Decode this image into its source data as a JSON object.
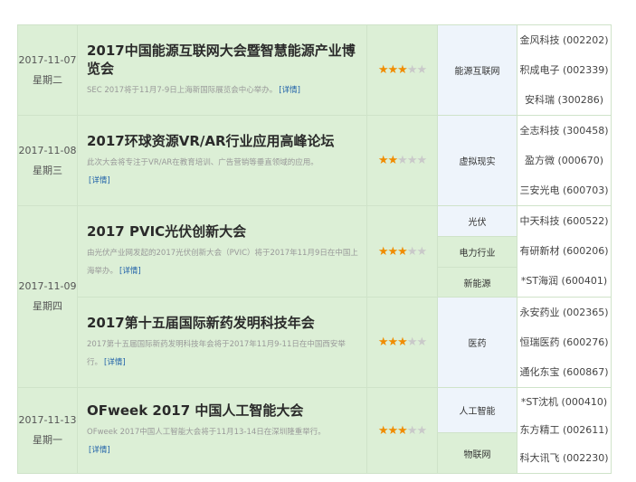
{
  "link_label": "[详情]",
  "events": [
    {
      "date": "2017-11-07",
      "weekday": "星期二",
      "title": "2017中国能源互联网大会暨智慧能源产业博览会",
      "desc": "SEC 2017将于11月7-9日上海新国际展览会中心举办。",
      "stars": 3,
      "industries": [
        {
          "name": "能源互联网"
        }
      ],
      "stocks": [
        "金风科技 (002202)",
        "积成电子 (002339)",
        "安科瑞 (300286)"
      ]
    },
    {
      "date": "2017-11-08",
      "weekday": "星期三",
      "title": "2017环球资源VR/AR行业应用高峰论坛",
      "desc": "此次大会将专注于VR/AR在教育培训、广告营销等垂直领域的应用。",
      "stars": 2,
      "industries": [
        {
          "name": "虚拟现实"
        }
      ],
      "stocks": [
        "全志科技 (300458)",
        "盈方微 (000670)",
        "三安光电 (600703)"
      ]
    },
    {
      "date": "2017-11-09",
      "weekday": "星期四",
      "title": "2017 PVIC光伏创新大会",
      "desc": "由光伏产业网发起的2017光伏创新大会（PVIC）将于2017年11月9日在中国上海举办。",
      "stars": 3,
      "industries": [
        {
          "name": "光伏"
        },
        {
          "name": "电力行业"
        },
        {
          "name": "新能源"
        }
      ],
      "stocks": [
        "中天科技 (600522)",
        "有研新材 (600206)",
        "*ST海润 (600401)"
      ]
    },
    {
      "title": "2017第十五届国际新药发明科技年会",
      "desc": "2017第十五届国际新药发明科技年会将于2017年11月9-11日在中国西安举行。",
      "stars": 3,
      "industries": [
        {
          "name": "医药"
        }
      ],
      "stocks": [
        "永安药业 (002365)",
        "恒瑞医药 (600276)",
        "通化东宝 (600867)"
      ]
    },
    {
      "date": "2017-11-13",
      "weekday": "星期一",
      "title": "OFweek 2017 中国人工智能大会",
      "desc": "OFweek 2017中国人工智能大会将于11月13-14日在深圳隆重举行。",
      "stars": 3,
      "industries": [
        {
          "name": "人工智能"
        },
        {
          "name": "物联网"
        }
      ],
      "stocks": [
        "*ST沈机 (000410)",
        "东方精工 (002611)",
        "科大讯飞 (002230)"
      ]
    }
  ],
  "colors": {
    "star_on": "#f08c00",
    "star_off": "#c9c9c9",
    "link": "#1d5fa8",
    "row_green": "#dcefd6",
    "cell_blue": "#eef4fb"
  }
}
